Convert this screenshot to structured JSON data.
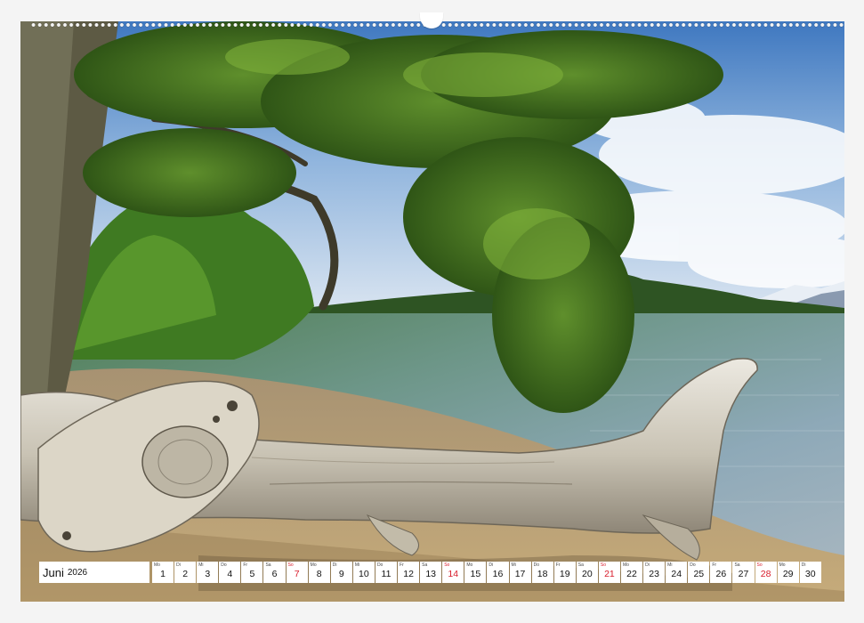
{
  "calendar": {
    "month": "Juni",
    "year": "2026",
    "days": [
      {
        "wd": "Mo",
        "n": "1"
      },
      {
        "wd": "Di",
        "n": "2"
      },
      {
        "wd": "Mi",
        "n": "3"
      },
      {
        "wd": "Do",
        "n": "4"
      },
      {
        "wd": "Fr",
        "n": "5"
      },
      {
        "wd": "Sa",
        "n": "6"
      },
      {
        "wd": "So",
        "n": "7"
      },
      {
        "wd": "Mo",
        "n": "8"
      },
      {
        "wd": "Di",
        "n": "9"
      },
      {
        "wd": "Mi",
        "n": "10"
      },
      {
        "wd": "Do",
        "n": "11"
      },
      {
        "wd": "Fr",
        "n": "12"
      },
      {
        "wd": "Sa",
        "n": "13"
      },
      {
        "wd": "So",
        "n": "14"
      },
      {
        "wd": "Mo",
        "n": "15"
      },
      {
        "wd": "Di",
        "n": "16"
      },
      {
        "wd": "Mi",
        "n": "17"
      },
      {
        "wd": "Do",
        "n": "18"
      },
      {
        "wd": "Fr",
        "n": "19"
      },
      {
        "wd": "Sa",
        "n": "20"
      },
      {
        "wd": "So",
        "n": "21"
      },
      {
        "wd": "Mo",
        "n": "22"
      },
      {
        "wd": "Di",
        "n": "23"
      },
      {
        "wd": "Mi",
        "n": "24"
      },
      {
        "wd": "Do",
        "n": "25"
      },
      {
        "wd": "Fr",
        "n": "26"
      },
      {
        "wd": "Sa",
        "n": "27"
      },
      {
        "wd": "So",
        "n": "28"
      },
      {
        "wd": "Mo",
        "n": "29"
      },
      {
        "wd": "Di",
        "n": "30"
      }
    ]
  },
  "colors": {
    "sunday": "#d81b2a",
    "sky": "#4f86c6",
    "water": "#8aa7b4",
    "foliage": "#4f7a26"
  }
}
